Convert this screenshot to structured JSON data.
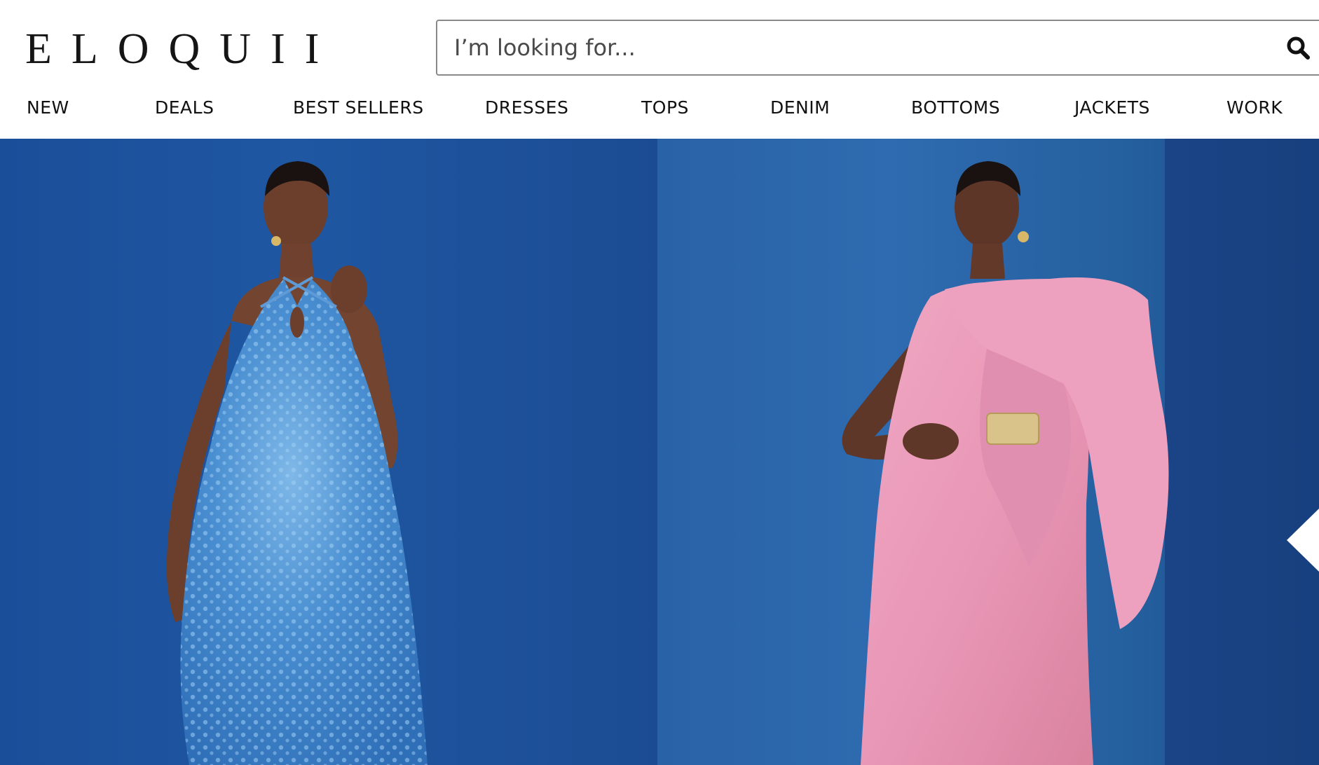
{
  "brand": {
    "logo_text": "ELOQUII"
  },
  "search": {
    "placeholder": "I’m looking for...",
    "value": "",
    "icon": "search-icon"
  },
  "nav": {
    "items": [
      {
        "label": "NEW"
      },
      {
        "label": "DEALS"
      },
      {
        "label": "BEST SELLERS"
      },
      {
        "label": "DRESSES"
      },
      {
        "label": "TOPS"
      },
      {
        "label": "DENIM"
      },
      {
        "label": "BOTTOMS"
      },
      {
        "label": "JACKETS"
      },
      {
        "label": "WORK"
      }
    ]
  },
  "hero": {
    "slides": [
      {
        "image": "model-in-blue-sequin-halter-dress",
        "dress_color": "#4a8fd1"
      },
      {
        "image": "model-in-pink-bow-column-gown",
        "dress_color": "#e99ab8"
      }
    ],
    "background_color": "#1d4f9c",
    "next_arrow_icon": "chevron-left-icon"
  },
  "colors": {
    "text": "#111111",
    "search_border": "#8a8a8a",
    "hero_blue": "#1f57a2",
    "skin": "#7a4a35"
  }
}
